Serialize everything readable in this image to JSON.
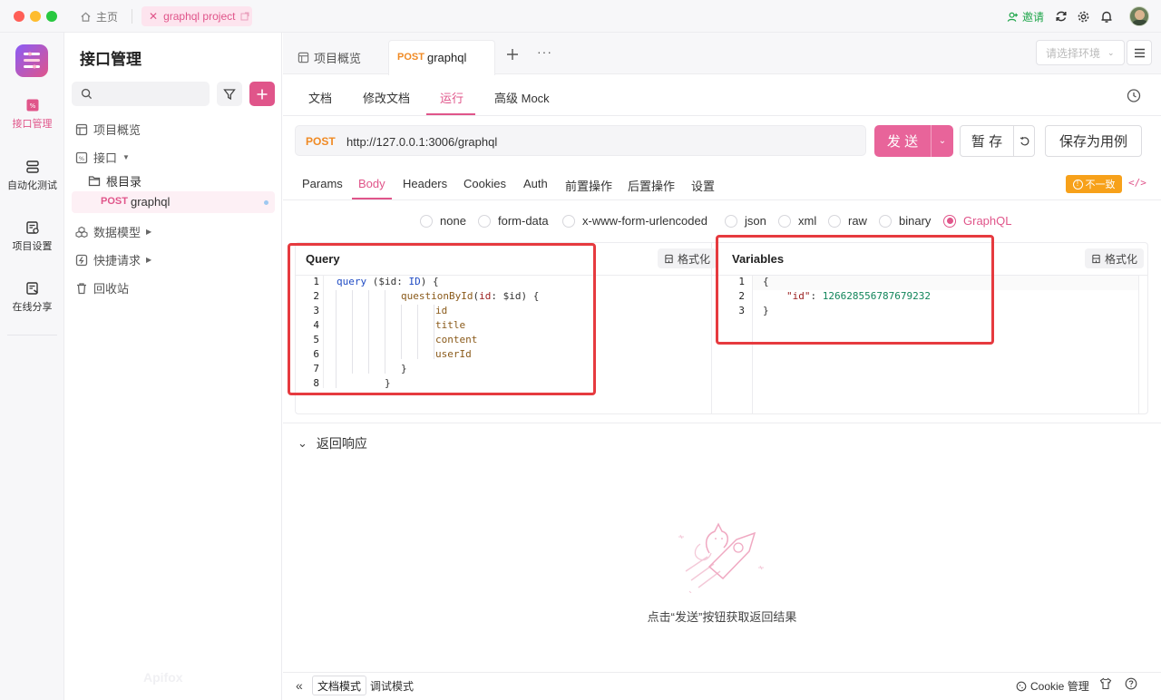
{
  "titlebar": {
    "home_label": "主页",
    "project_tab_label": "graphql project",
    "invite_label": "邀请",
    "colors": {
      "close": "#ff5f57",
      "minimize": "#febc2e",
      "maximize": "#28c840",
      "invite": "#1fa64b"
    }
  },
  "rail": {
    "items": [
      {
        "label": "接口管理",
        "icon": "api-icon"
      },
      {
        "label": "自动化测试",
        "icon": "stack-icon"
      },
      {
        "label": "项目设置",
        "icon": "settings-doc-icon"
      },
      {
        "label": "在线分享",
        "icon": "share-doc-icon"
      }
    ],
    "accent": "#e0558a"
  },
  "sidebar": {
    "title": "接口管理",
    "search_placeholder": "",
    "items": {
      "overview": "项目概览",
      "api": "接口",
      "root": "根目录",
      "endpoint_method": "POST",
      "endpoint_name": "graphql",
      "data_model": "数据模型",
      "quick_request": "快捷请求",
      "trash": "回收站"
    },
    "watermark": "Apifox"
  },
  "main": {
    "tabs": {
      "overview": "项目概览",
      "active_method": "POST",
      "active_name": "graphql"
    },
    "env_placeholder": "请选择环境",
    "subtabs": [
      "文档",
      "修改文档",
      "运行",
      "高级 Mock"
    ],
    "active_subtab": "运行",
    "request": {
      "method": "POST",
      "url": "http://127.0.0.1:3006/graphql",
      "send": "发 送",
      "save": "暂 存",
      "save_as_case": "保存为用例"
    },
    "body_tabs": [
      "Params",
      "Body",
      "Headers",
      "Cookies",
      "Auth",
      "前置操作",
      "后置操作",
      "设置"
    ],
    "active_body_tab": "Body",
    "mismatch_badge": "不一致",
    "body_types": [
      "none",
      "form-data",
      "x-www-form-urlencoded",
      "json",
      "xml",
      "raw",
      "binary",
      "GraphQL"
    ],
    "selected_body_type": "GraphQL",
    "query": {
      "title": "Query",
      "format_label": "格式化",
      "line_numbers": [
        "1",
        "2",
        "3",
        "4",
        "5",
        "6",
        "7",
        "8"
      ],
      "l1_kw": "query",
      "l1_rest_a": " ($id: ",
      "l1_type": "ID",
      "l1_rest_b": ") {",
      "l2_field": "questionById",
      "l2_open": "(",
      "l2_arg": "id",
      "l2_rest": ": $id) {",
      "l3": "id",
      "l4": "title",
      "l5": "content",
      "l6": "userId",
      "l7": "}",
      "l8": "}"
    },
    "variables": {
      "title": "Variables",
      "format_label": "格式化",
      "line_numbers": [
        "1",
        "2",
        "3"
      ],
      "l1": "{",
      "l2_key": "\"id\"",
      "l2_colon": ": ",
      "l2_value": "126628556787679232",
      "l3": "}"
    },
    "response": {
      "title": "返回响应",
      "empty_hint": "点击“发送”按钮获取返回结果"
    }
  },
  "footer": {
    "doc_mode": "文档模式",
    "debug_mode": "调试模式",
    "cookie_mgmt": "Cookie 管理"
  }
}
